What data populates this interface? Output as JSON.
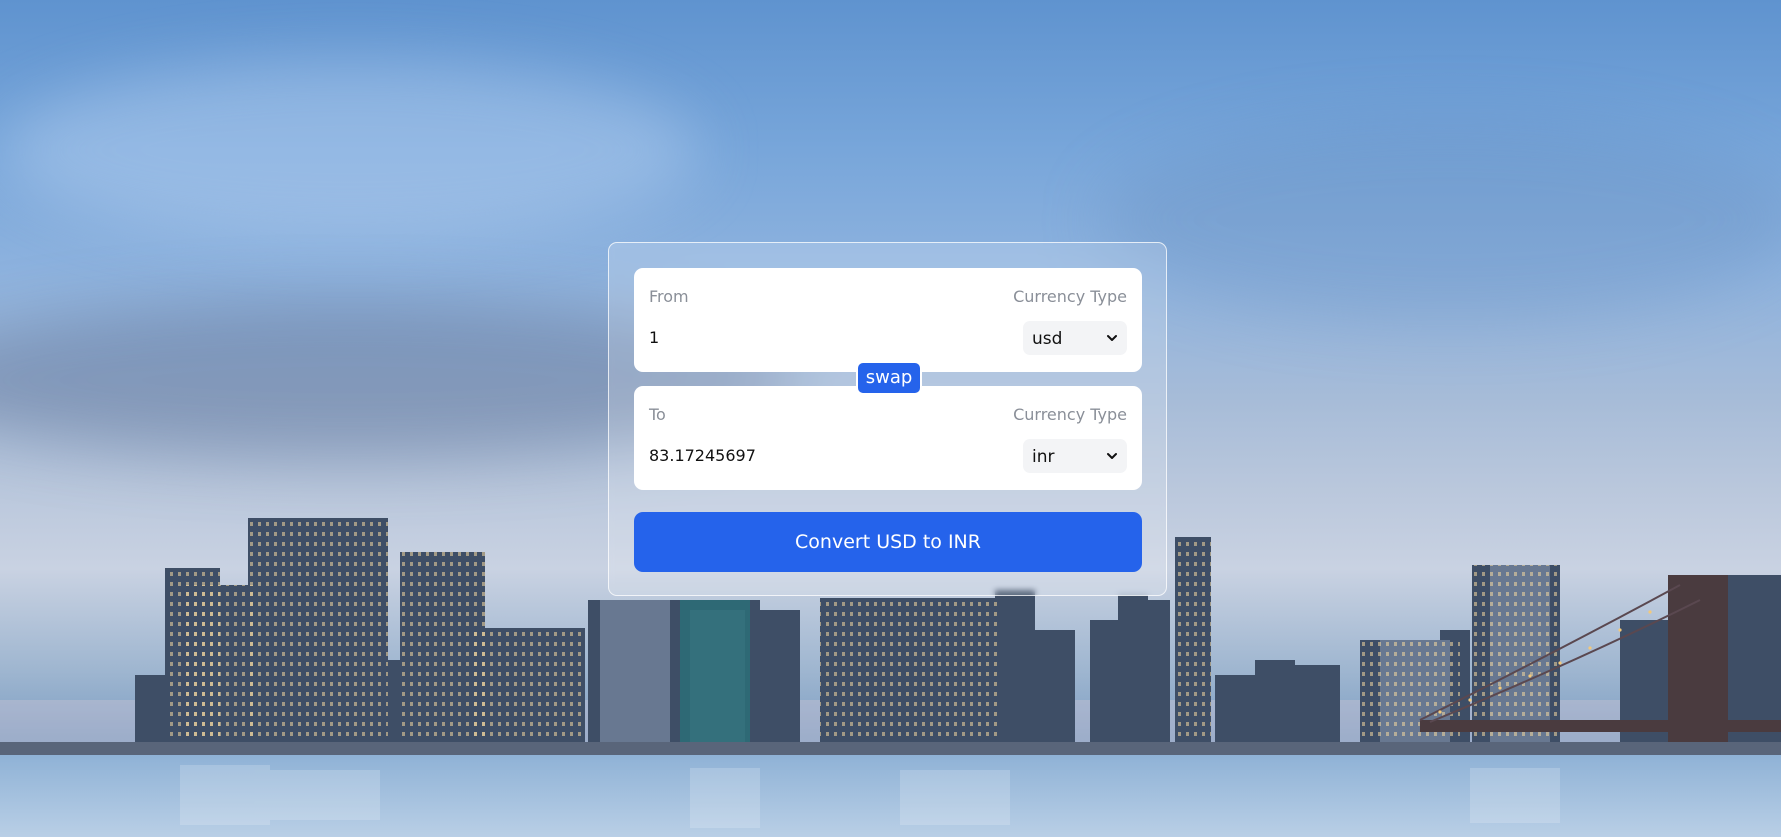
{
  "converter": {
    "from": {
      "label": "From",
      "currency_label": "Currency Type",
      "amount": "1",
      "currency": "usd"
    },
    "to": {
      "label": "To",
      "currency_label": "Currency Type",
      "amount": "83.17245697",
      "currency": "inr"
    },
    "swap_label": "swap",
    "convert_label": "Convert USD to INR"
  },
  "colors": {
    "accent": "#2563eb",
    "panel": "#ffffff",
    "select_bg": "#f3f4f6"
  },
  "icons": {
    "select_arrow": "chevron-down-icon"
  }
}
